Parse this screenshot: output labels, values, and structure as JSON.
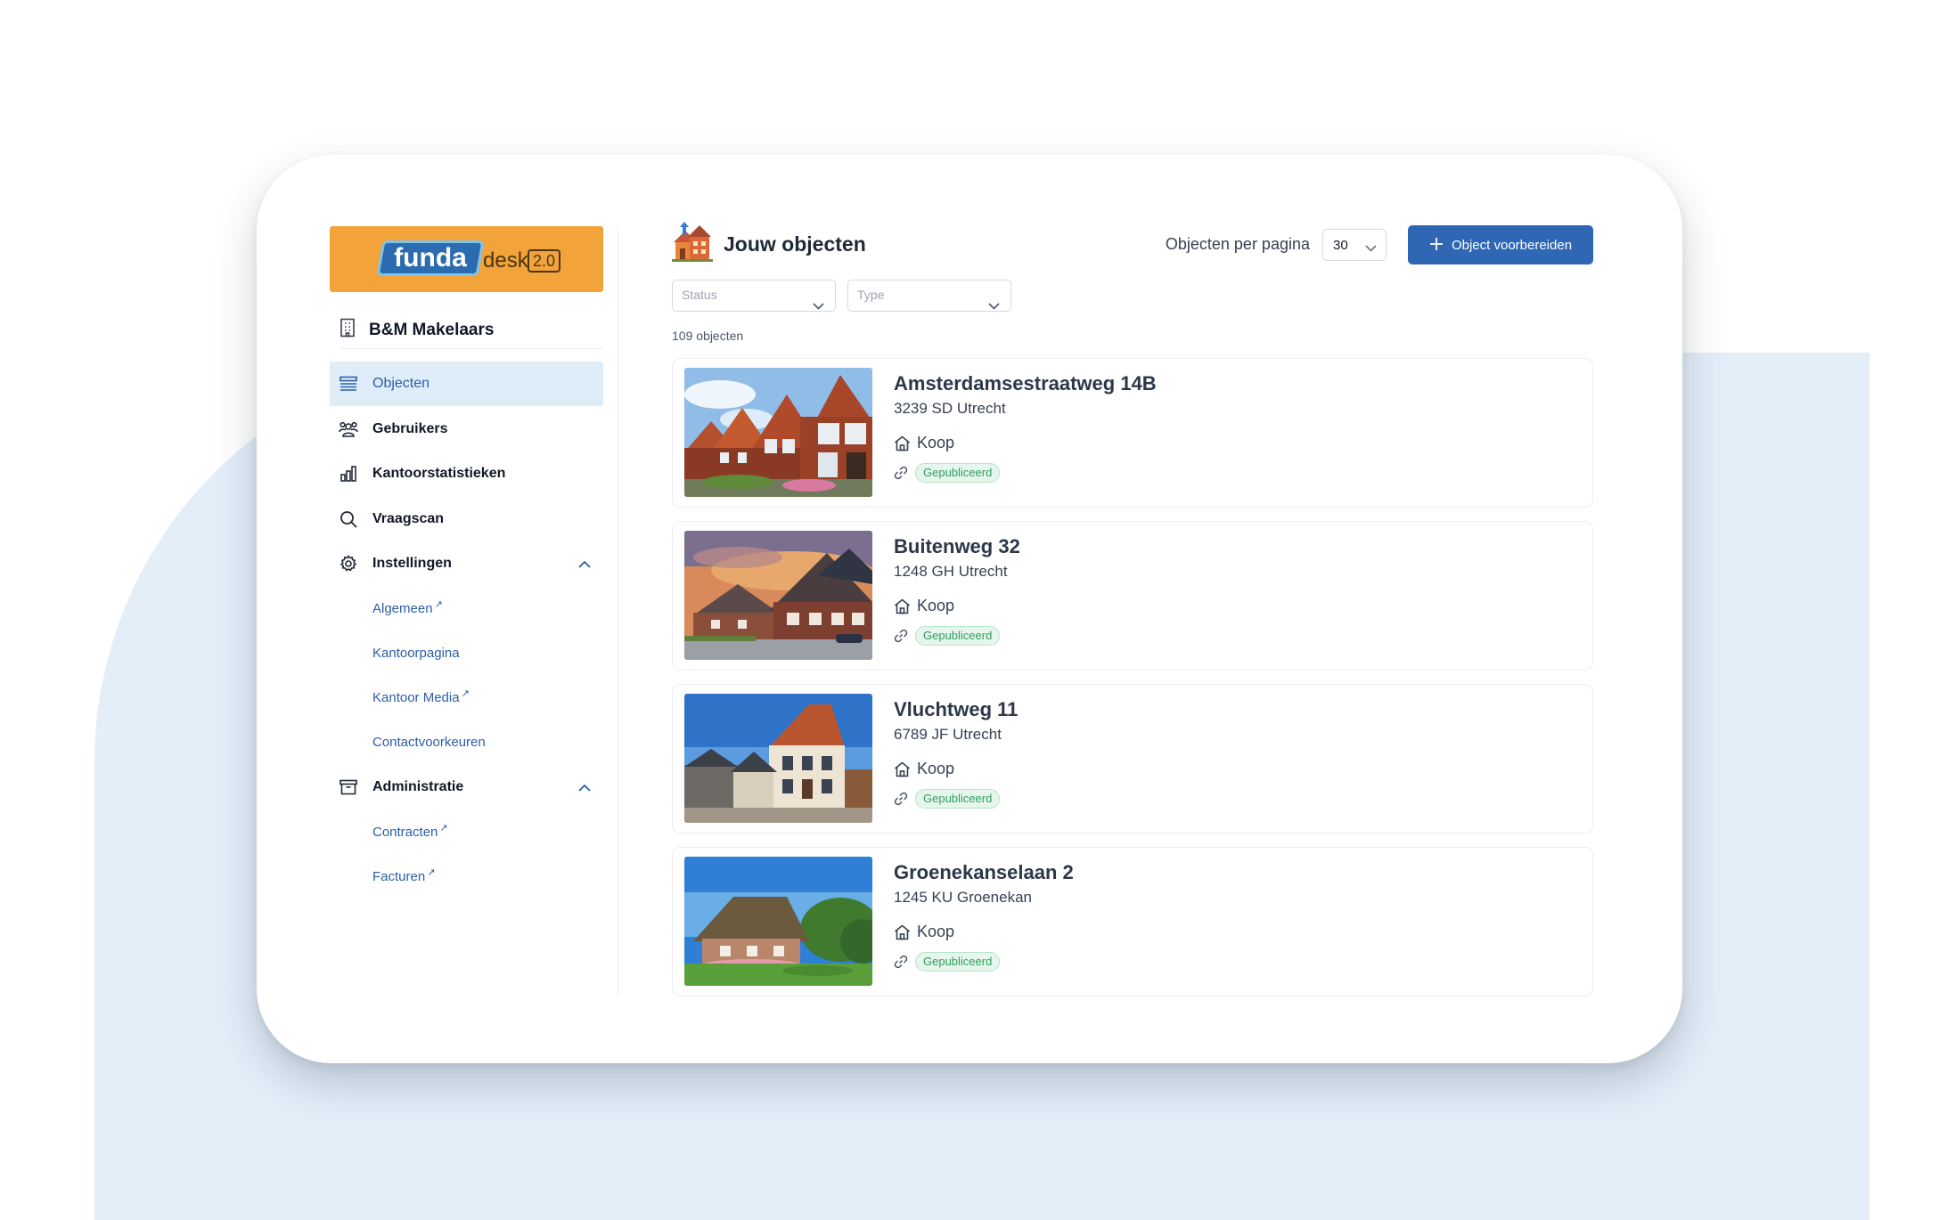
{
  "brand": {
    "logo_word": "funda",
    "logo_product": "desk",
    "logo_version": "2.0"
  },
  "organization": {
    "name": "B&M Makelaars",
    "icon": "building-icon"
  },
  "nav": {
    "objecten": "Objecten",
    "gebruikers": "Gebruikers",
    "kantoorstatistieken": "Kantoorstatistieken",
    "vraagscan": "Vraagscan",
    "instellingen": "Instellingen",
    "instellingen_items": [
      "Algemeen",
      "Kantoorpagina",
      "Kantoor Media",
      "Contactvoorkeuren"
    ],
    "administratie": "Administratie",
    "administratie_items": [
      "Contracten",
      "Facturen"
    ],
    "external_mark": "↗"
  },
  "header": {
    "title": "Jouw objecten",
    "per_page_label": "Objecten per pagina",
    "per_page_value": "30",
    "prepare_button": "Object voorbereiden"
  },
  "filters": {
    "status_placeholder": "Status",
    "type_placeholder": "Type"
  },
  "results_count": "109 objecten",
  "listings": [
    {
      "street": "Amsterdamsestraatweg 14B",
      "postcode": "3239 SD Utrecht",
      "type": "Koop",
      "status": "Gepubliceerd"
    },
    {
      "street": "Buitenweg 32",
      "postcode": "1248 GH Utrecht",
      "type": "Koop",
      "status": "Gepubliceerd"
    },
    {
      "street": "Vluchtweg 11",
      "postcode": "6789 JF Utrecht",
      "type": "Koop",
      "status": "Gepubliceerd"
    },
    {
      "street": "Groenekanselaan 2",
      "postcode": "1245 KU Groenekan",
      "type": "Koop",
      "status": "Gepubliceerd"
    }
  ],
  "colors": {
    "accent": "#2f67b4",
    "logo_background": "#f2a33a",
    "active_nav_background": "#dfedf9",
    "badge_green": "#2f9e5e",
    "page_background_blob": "#e3eef9"
  }
}
